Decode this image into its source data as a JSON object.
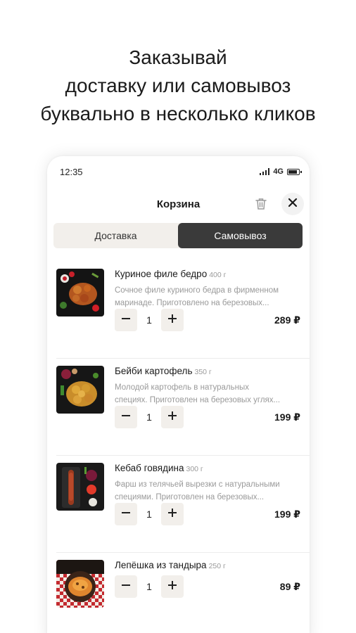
{
  "promo": {
    "line1": "Заказывай",
    "line2": "доставку или самовывоз",
    "line3": "буквально в несколько кликов"
  },
  "status_bar": {
    "time": "12:35",
    "network": "4G"
  },
  "header": {
    "title": "Корзина",
    "trash_icon": "trash-icon",
    "close_icon": "close-icon"
  },
  "delivery_toggle": {
    "options": [
      "Доставка",
      "Самовывоз"
    ],
    "selected": "Самовывоз"
  },
  "cart": {
    "items": [
      {
        "name": "Куриное филе бедро",
        "weight": "400 г",
        "desc_line1": "Сочное филе куриного бедра в фирменном",
        "desc_line2": "маринаде. Приготовлено на березовых...",
        "quantity": "1",
        "price": "289 ₽"
      },
      {
        "name": "Бейби картофель",
        "weight": "350 г",
        "desc_line1": "Молодой картофель в натуральных",
        "desc_line2": "специях. Приготовлен на березовых углях...",
        "quantity": "1",
        "price": "199 ₽"
      },
      {
        "name": "Кебаб говядина",
        "weight": "300 г",
        "desc_line1": "Фарш из телячьей вырезки с натуральными",
        "desc_line2": "специями. Приготовлен на березовых...",
        "quantity": "1",
        "price": "199 ₽"
      },
      {
        "name": "Лепёшка из тандыра",
        "weight": "250 г",
        "quantity": "1",
        "price": "89 ₽"
      }
    ],
    "minus_icon": "minus-icon",
    "plus_icon": "plus-icon"
  },
  "colors": {
    "segment_bg": "#f2efeb",
    "segment_active": "#3a3a3a",
    "muted_text": "#9a9a9a"
  }
}
